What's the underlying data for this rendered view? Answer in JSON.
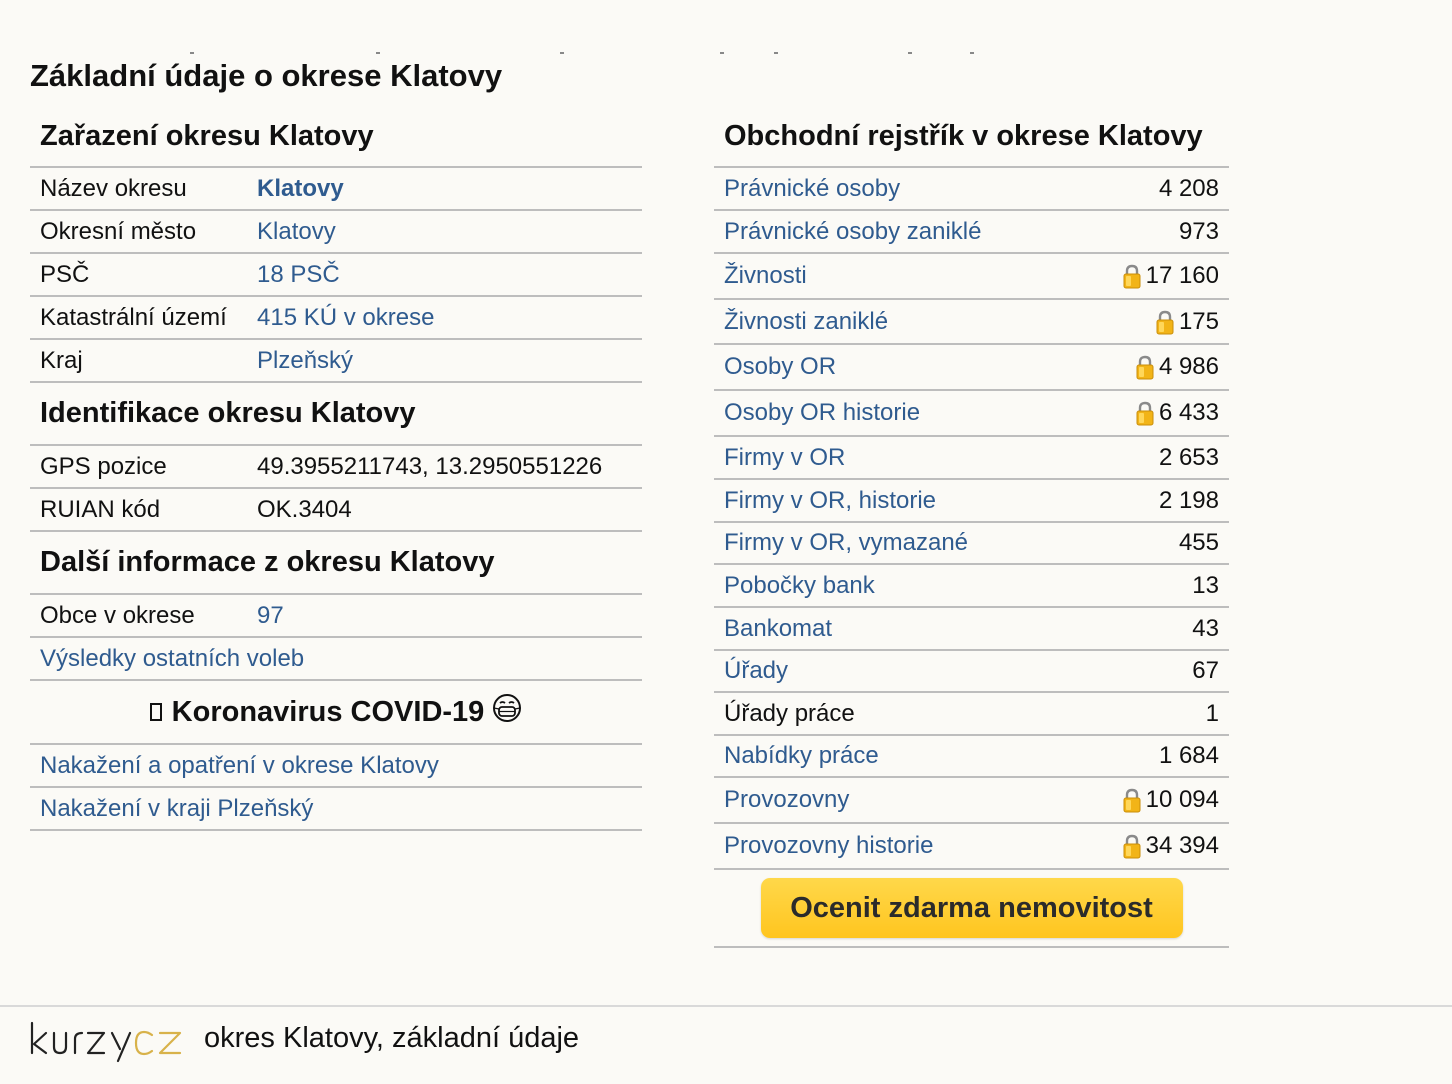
{
  "page_title": "Základní údaje o okrese Klatovy",
  "left": {
    "zarazeni": {
      "heading": "Zařazení okresu Klatovy",
      "rows": [
        {
          "label": "Název okresu",
          "value": "Klatovy"
        },
        {
          "label": "Okresní město",
          "value": "Klatovy"
        },
        {
          "label": "PSČ",
          "value": "18 PSČ"
        },
        {
          "label": "Katastrální území",
          "value": "415 KÚ v okrese"
        },
        {
          "label": "Kraj",
          "value": "Plzeňský"
        }
      ]
    },
    "identifikace": {
      "heading": "Identifikace okresu Klatovy",
      "rows": [
        {
          "label": "GPS pozice",
          "value": "49.3955211743, 13.2950551226"
        },
        {
          "label": "RUIAN kód",
          "value": "OK.3404"
        }
      ]
    },
    "dalsi": {
      "heading": "Další informace z okresu Klatovy",
      "obce_label": "Obce v okrese",
      "obce_value": "97",
      "volby_link": "Výsledky ostatních voleb"
    },
    "covid": {
      "heading": "Koronavirus COVID-19",
      "links": [
        "Nakažení a opatření v okrese Klatovy",
        "Nakažení v kraji Plzeňský"
      ]
    }
  },
  "right": {
    "heading": "Obchodní rejstřík v okrese Klatovy",
    "rows": [
      {
        "label": "Právnické osoby",
        "value": "4 208",
        "locked": false
      },
      {
        "label": "Právnické osoby zaniklé",
        "value": "973",
        "locked": false
      },
      {
        "label": "Živnosti",
        "value": "17 160",
        "locked": true
      },
      {
        "label": "Živnosti zaniklé",
        "value": "175",
        "locked": true
      },
      {
        "label": "Osoby OR",
        "value": "4 986",
        "locked": true
      },
      {
        "label": "Osoby OR historie",
        "value": "6 433",
        "locked": true
      },
      {
        "label": "Firmy v OR",
        "value": "2 653",
        "locked": false
      },
      {
        "label": "Firmy v OR, historie",
        "value": "2 198",
        "locked": false
      },
      {
        "label": "Firmy v OR, vymazané",
        "value": "455",
        "locked": false
      },
      {
        "label": "Pobočky bank",
        "value": "13",
        "locked": false
      },
      {
        "label": "Bankomat",
        "value": "43",
        "locked": false
      },
      {
        "label": "Úřady",
        "value": "67",
        "locked": false
      },
      {
        "label": "Úřady práce",
        "value": "1",
        "locked": false
      },
      {
        "label": "Nabídky práce",
        "value": "1 684",
        "locked": false
      },
      {
        "label": "Provozovny",
        "value": "10 094",
        "locked": true
      },
      {
        "label": "Provozovny historie",
        "value": "34 394",
        "locked": true
      }
    ],
    "button_label": "Ocenit zdarma nemovitost"
  },
  "footer": {
    "logo_text": "kurzycz",
    "text": "okres Klatovy, základní údaje"
  },
  "colors": {
    "link": "#2f5b8f",
    "button": "#ffc51f",
    "background": "#fbfaf6",
    "logo_accent": "#d8b24a"
  }
}
